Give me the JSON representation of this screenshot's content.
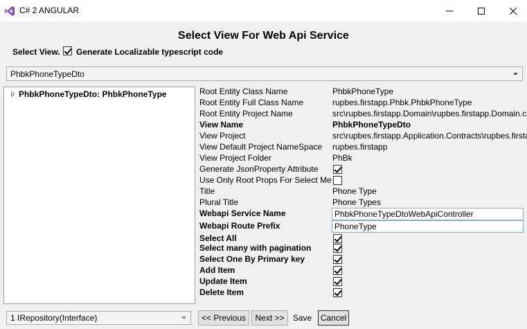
{
  "window": {
    "title": "C# 2 ANGULAR",
    "icon": "visual-studio-icon"
  },
  "heading": "Select View For Web Api Service",
  "select_view_label": "Select View.",
  "localizable": {
    "label": "Generate Localizable typescript code",
    "checked": true
  },
  "view_combo": {
    "selected": "PhbkPhoneTypeDto"
  },
  "tree": {
    "item_label": "PhbkPhoneTypeDto: PhbkPhoneType"
  },
  "properties": [
    {
      "name": "Root Entity Class Name",
      "value": "PhbkPhoneType",
      "kind": "text",
      "bold": false
    },
    {
      "name": "Root Entity Full Class Name",
      "value": "rupbes.firstapp.Phbk.PhbkPhoneType",
      "kind": "text",
      "bold": false
    },
    {
      "name": "Root Entity Project Name",
      "value": "src\\rupbes.firstapp.Domain\\rupbes.firstapp.Domain.csproj",
      "kind": "text",
      "bold": false
    },
    {
      "name": "View Name",
      "value": "PhbkPhoneTypeDto",
      "kind": "text",
      "bold": true
    },
    {
      "name": "View Project",
      "value": "src\\rupbes.firstapp.Application.Contracts\\rupbes.firstapp.Application.Contracts.csproj",
      "kind": "text",
      "bold": false
    },
    {
      "name": "View Default Project NameSpace",
      "value": "rupbes.firstapp",
      "kind": "text",
      "bold": false
    },
    {
      "name": "View Project Folder",
      "value": "PhBk",
      "kind": "text",
      "bold": false
    },
    {
      "name": "Generate JsonProperty Attribute",
      "checked": true,
      "kind": "checkbox",
      "bold": false
    },
    {
      "name": "Use Only Root Props For Select Method",
      "checked": false,
      "kind": "checkbox",
      "bold": false
    },
    {
      "name": "Title",
      "value": "Phone Type",
      "kind": "text",
      "bold": false
    },
    {
      "name": "Plural Title",
      "value": "Phone Types",
      "kind": "text",
      "bold": false
    },
    {
      "name": "Webapi Service Name",
      "value": "PhbkPhoneTypeDtoWebApiController",
      "kind": "input",
      "bold": true
    },
    {
      "name": "Webapi Route Prefix",
      "value": "PhoneType",
      "kind": "input",
      "bold": true,
      "focused": true
    },
    {
      "name": "Select All",
      "checked": true,
      "kind": "checkbox",
      "bold": true
    },
    {
      "name": "Select many with pagination",
      "checked": true,
      "kind": "checkbox",
      "bold": true
    },
    {
      "name": "Select One By Primary key",
      "checked": true,
      "kind": "checkbox",
      "bold": true
    },
    {
      "name": "Add Item",
      "checked": true,
      "kind": "checkbox",
      "bold": true
    },
    {
      "name": "Update Item",
      "checked": true,
      "kind": "checkbox",
      "bold": true
    },
    {
      "name": "Delete Item",
      "checked": true,
      "kind": "checkbox",
      "bold": true
    }
  ],
  "repo_combo": {
    "selected": "1 IRepository(Interface)"
  },
  "buttons": {
    "previous": "<< Previous",
    "next": "Next >>",
    "save": "Save",
    "cancel": "Cancel"
  }
}
